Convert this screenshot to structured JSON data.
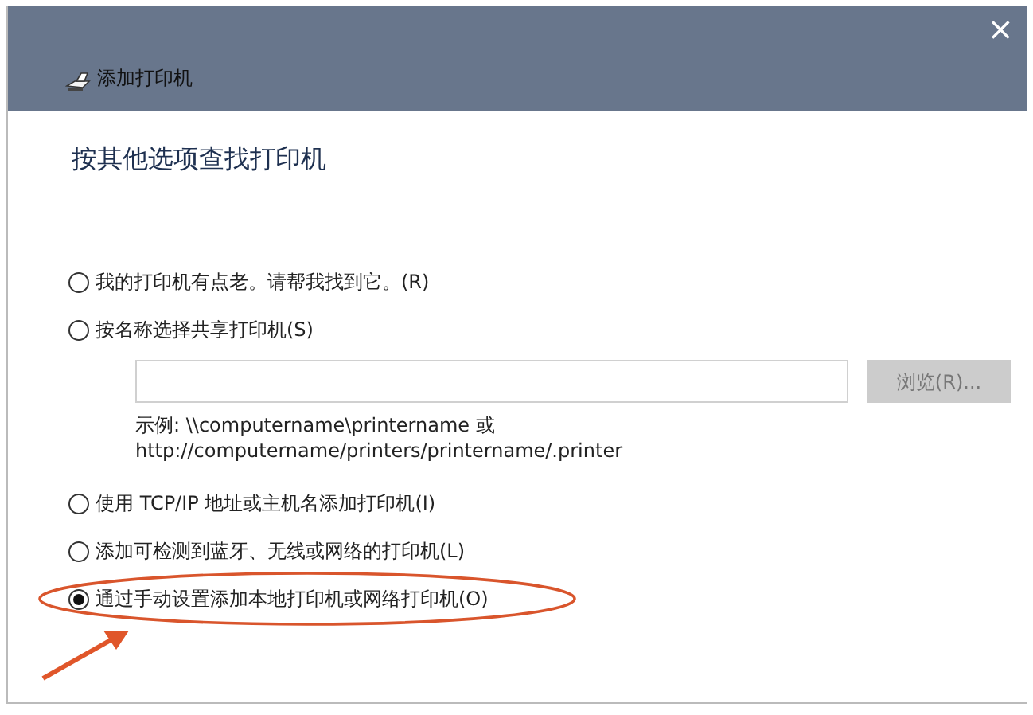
{
  "window": {
    "title": "添加打印机",
    "close": "×"
  },
  "heading": "按其他选项查找打印机",
  "options": [
    {
      "label": "我的打印机有点老。请帮我找到它。(R)",
      "selected": false
    },
    {
      "label": "按名称选择共享打印机(S)",
      "selected": false,
      "kind": "share"
    },
    {
      "label": "使用 TCP/IP 地址或主机名添加打印机(I)",
      "selected": false
    },
    {
      "label": "添加可检测到蓝牙、无线或网络的打印机(L)",
      "selected": false
    },
    {
      "label": "通过手动设置添加本地打印机或网络打印机(O)",
      "selected": true
    }
  ],
  "share": {
    "browse_button": {
      "label": "浏览(R)...",
      "disabled": true
    },
    "example_lines": [
      "示例: \\\\computername\\printername 或",
      "http://computername/printers/printername/.printer"
    ]
  }
}
